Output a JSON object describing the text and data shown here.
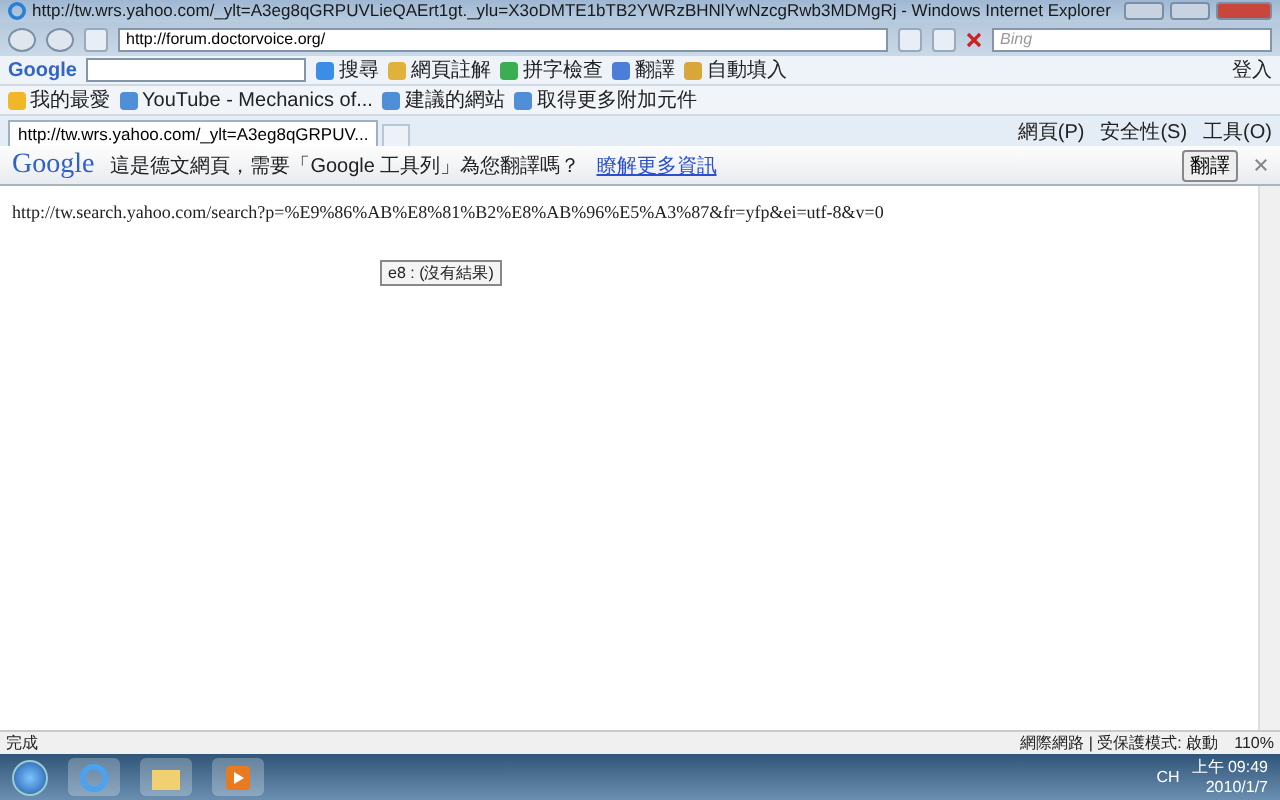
{
  "window": {
    "title": "http://tw.wrs.yahoo.com/_ylt=A3eg8qGRPUVLieQAErt1gt._ylu=X3oDMTE1bTB2YWRzBHNlYwNzcgRwb3MDMgRj - Windows Internet Explorer"
  },
  "address_bar": {
    "value": "http://forum.doctorvoice.org/"
  },
  "search_box": {
    "placeholder": "Bing"
  },
  "google_toolbar": {
    "logo": "Google",
    "items": [
      {
        "label": "搜尋"
      },
      {
        "label": "網頁註解"
      },
      {
        "label": "拼字檢查"
      },
      {
        "label": "翻譯"
      },
      {
        "label": "自動填入"
      }
    ],
    "sign_in": "登入"
  },
  "favorites_bar": {
    "items": [
      {
        "label": "我的最愛"
      },
      {
        "label": "YouTube - Mechanics of..."
      },
      {
        "label": "建議的網站"
      },
      {
        "label": "取得更多附加元件"
      }
    ]
  },
  "tabs": [
    {
      "label": "http://tw.wrs.yahoo.com/_ylt=A3eg8qGRPUV...",
      "selected": true
    }
  ],
  "command_bar": {
    "items": [
      {
        "label": "網頁(P)"
      },
      {
        "label": "安全性(S)"
      },
      {
        "label": "工具(O)"
      }
    ]
  },
  "translate_bar": {
    "logo": "Google",
    "message": "這是德文網頁，需要「Google 工具列」為您翻譯嗎？",
    "link": "瞭解更多資訊",
    "button": "翻譯"
  },
  "content": {
    "text": "http://tw.search.yahoo.com/search?p=%E9%86%AB%E8%81%B2%E8%AB%96%E5%A3%87&fr=yfp&ei=utf-8&v=0",
    "tooltip": "e8 : (沒有結果)"
  },
  "status_bar": {
    "status": "完成",
    "zone": "網際網路 | 受保護模式: 啟動",
    "zoom": "110%"
  },
  "taskbar": {
    "language": "CH",
    "time": "上午 09:49",
    "date": "2010/1/7"
  }
}
